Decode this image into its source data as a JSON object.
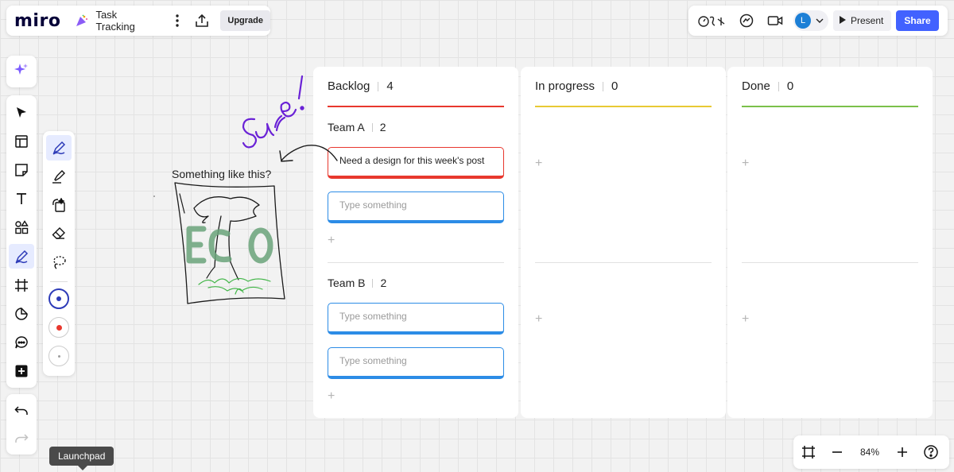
{
  "app": {
    "logo": "miro",
    "board_title": "Task Tracking",
    "upgrade_label": "Upgrade"
  },
  "header": {
    "present_label": "Present",
    "share_label": "Share",
    "avatar_initial": "L"
  },
  "tooltip": {
    "launchpad": "Launchpad"
  },
  "zoom": {
    "value": "84%"
  },
  "canvas": {
    "caption": "Something like this?"
  },
  "columns": [
    {
      "title": "Backlog",
      "count": "4",
      "accent": "#e8382e",
      "groups": [
        {
          "title": "Team A",
          "count": "2",
          "cards": [
            {
              "text": "Need a design for this week's post",
              "placeholder": false
            },
            {
              "text": "Type something",
              "placeholder": true
            }
          ]
        },
        {
          "title": "Team B",
          "count": "2",
          "cards": [
            {
              "text": "Type something",
              "placeholder": true
            },
            {
              "text": "Type something",
              "placeholder": true
            }
          ]
        }
      ]
    },
    {
      "title": "In progress",
      "count": "0",
      "accent": "#e8c934"
    },
    {
      "title": "Done",
      "count": "0",
      "accent": "#7bc04a"
    }
  ],
  "plus_sign": "+",
  "icons": {
    "top_left": [
      "party-popper-icon",
      "kebab-menu-icon",
      "upload-icon"
    ],
    "top_right": [
      "timer-reactions-icon",
      "chat-icon",
      "video-icon",
      "chevron-down-icon",
      "play-icon"
    ],
    "left_tools": [
      "sparkle-icon",
      "select-arrow-icon",
      "templates-icon",
      "sticky-note-icon",
      "text-icon",
      "shapes-icon",
      "pen-icon",
      "frame-icon",
      "sticker-icon",
      "comment-icon",
      "more-apps-icon",
      "undo-icon",
      "redo-icon"
    ],
    "pen_tools": [
      "pen-icon",
      "highlighter-icon",
      "smart-draw-icon",
      "eraser-icon",
      "lasso-icon"
    ],
    "zoom_bar": [
      "fit-frame-icon",
      "zoom-out-icon",
      "zoom-in-icon",
      "help-icon"
    ]
  },
  "colors": {
    "accent_blue": "#4262ff",
    "card_border_blue": "#2c8ce6",
    "card_border_red": "#e8382e",
    "pen_colors": [
      "#2d3bb8",
      "#e8382e",
      "#9e9e9e"
    ]
  }
}
